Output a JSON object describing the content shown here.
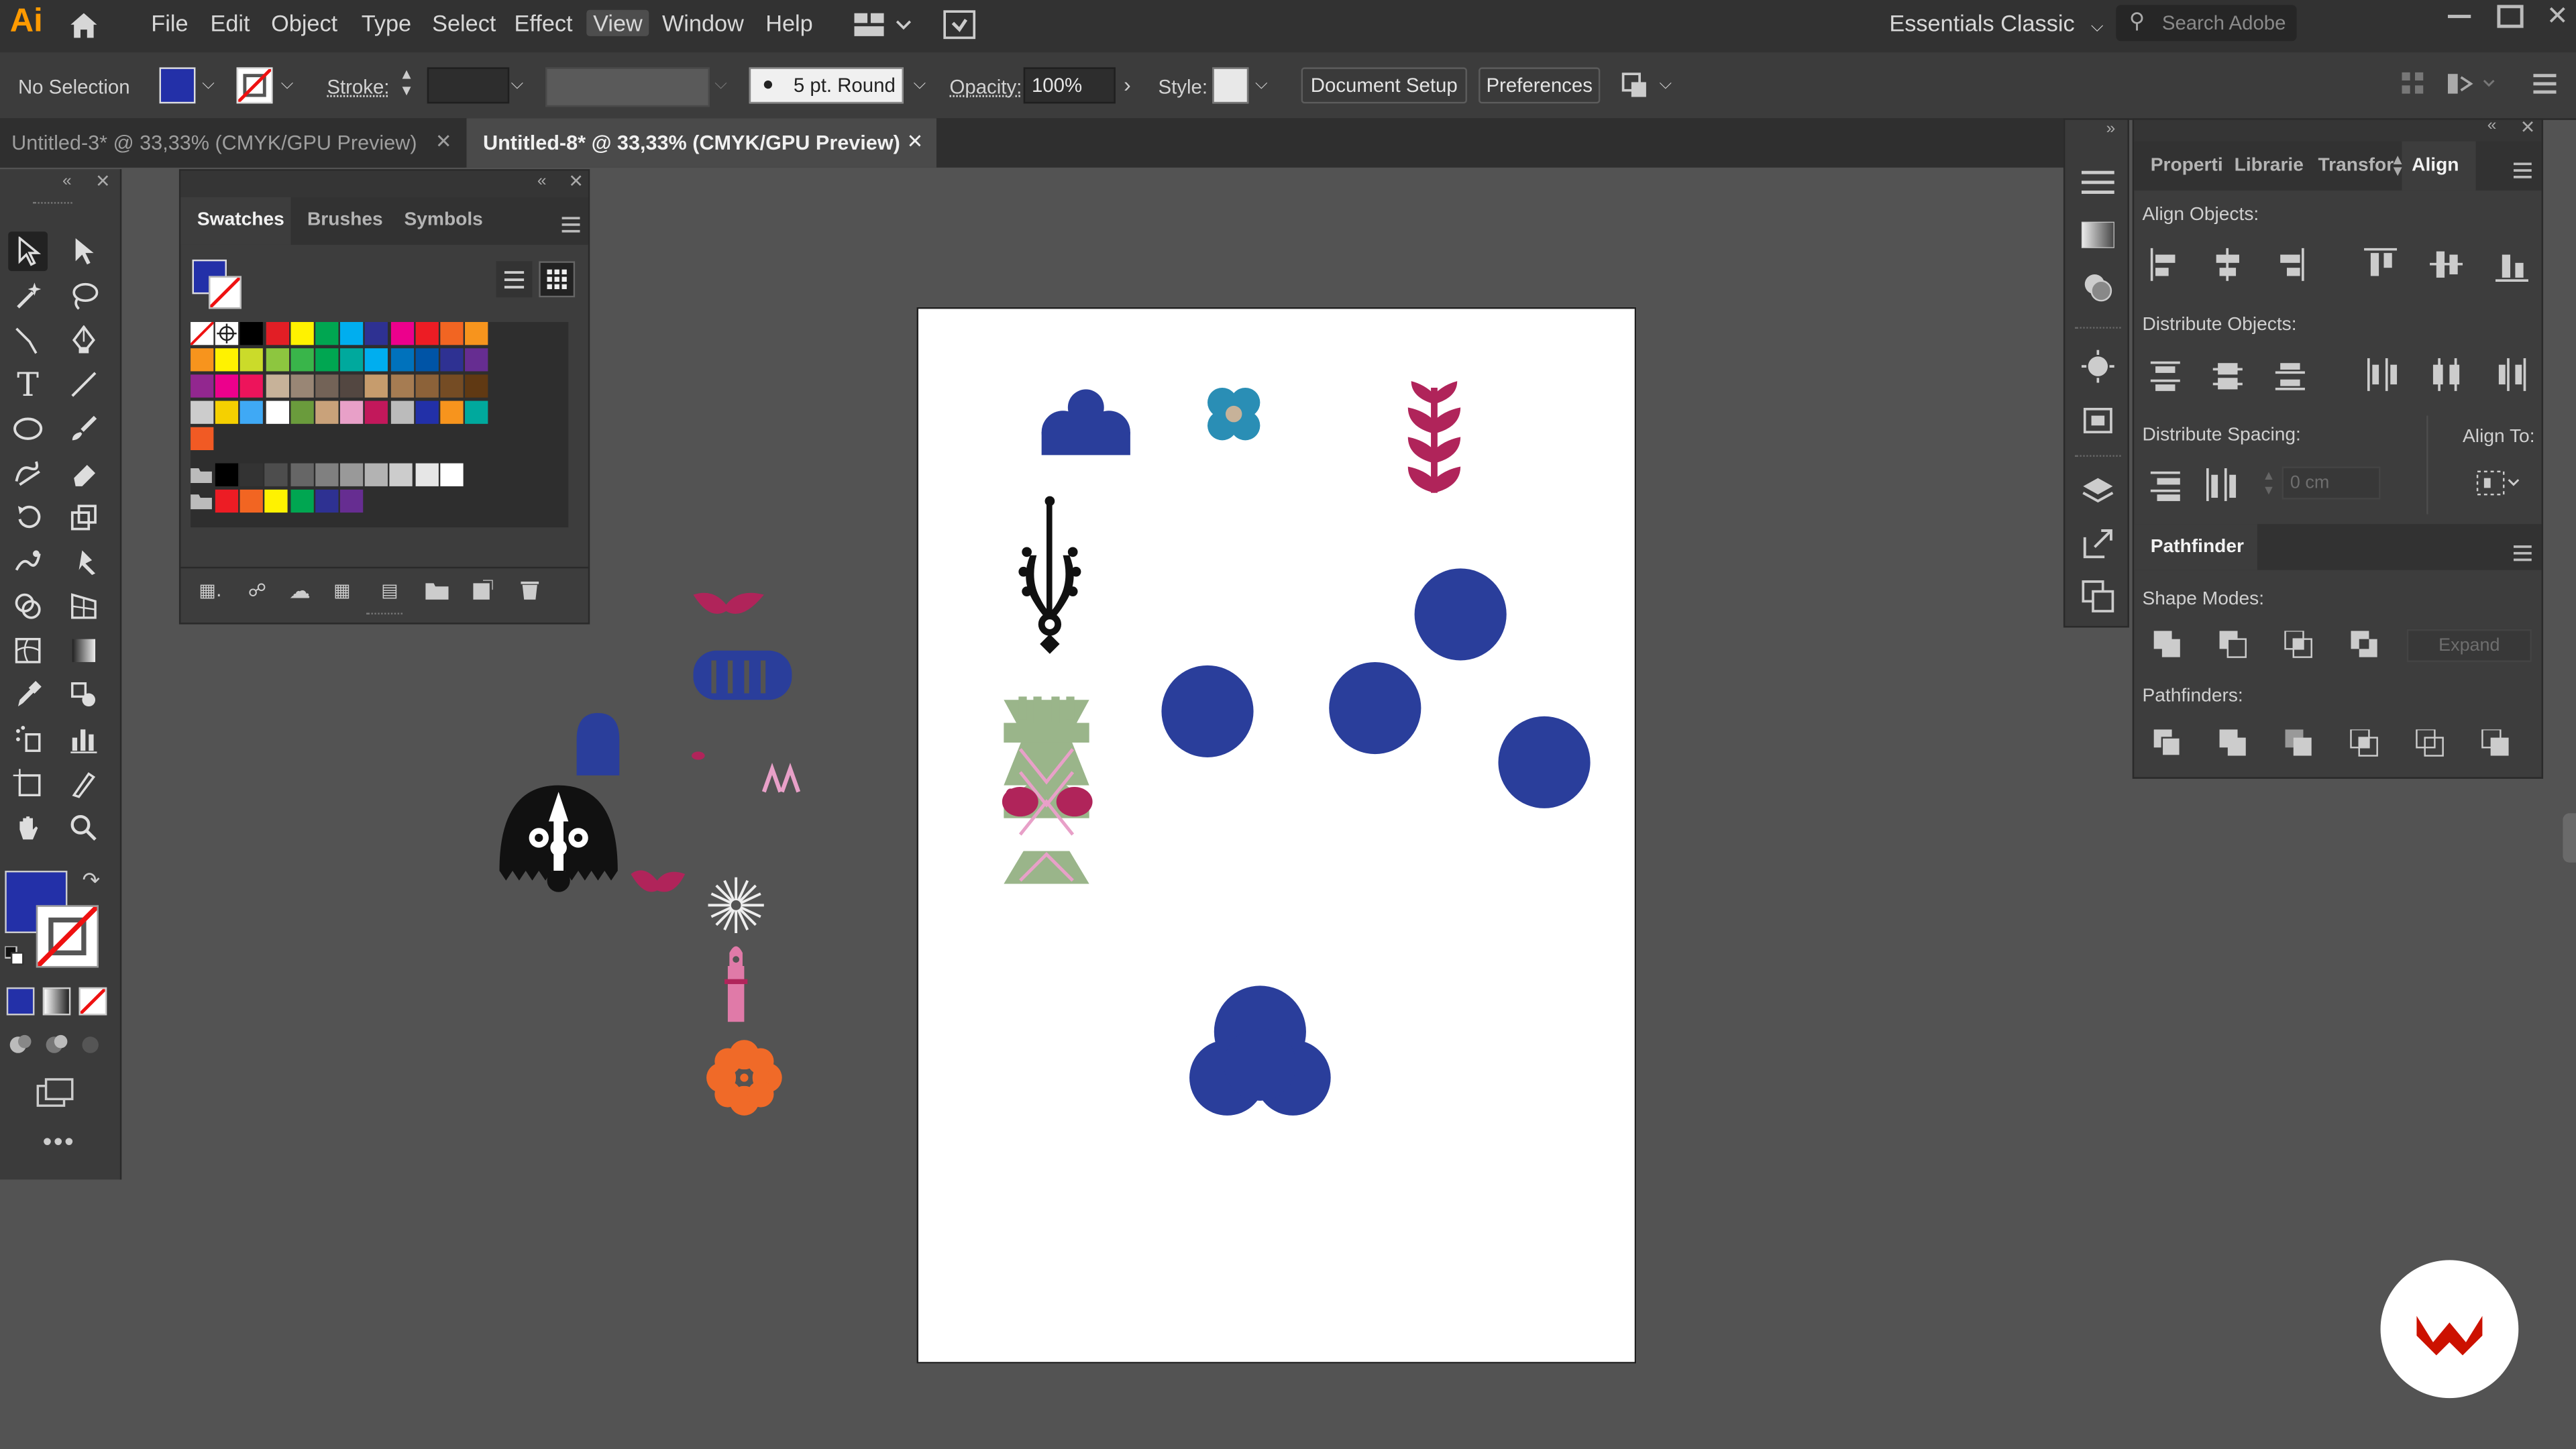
{
  "app": {
    "logo_text": "Ai",
    "menu": [
      "File",
      "Edit",
      "Object",
      "Type",
      "Select",
      "Effect",
      "View",
      "Window",
      "Help"
    ],
    "active_menu": "View",
    "workspace": "Essentials Classic",
    "search_placeholder": "Search Adobe"
  },
  "control_bar": {
    "selection": "No Selection",
    "stroke_label": "Stroke:",
    "brush": "5 pt. Round",
    "opacity_label": "Opacity:",
    "opacity_value": "100%",
    "style_label": "Style:",
    "document_setup": "Document Setup",
    "preferences": "Preferences"
  },
  "tabs": [
    {
      "label": "Untitled-3* @ 33,33% (CMYK/GPU Preview)",
      "active": false
    },
    {
      "label": "Untitled-8* @ 33,33% (CMYK/GPU Preview)",
      "active": true
    }
  ],
  "swatches_panel": {
    "tabs": [
      "Swatches",
      "Brushes",
      "Symbols"
    ],
    "active_tab": "Swatches",
    "row1": [
      "#000000",
      "#ffffff",
      "#000000",
      "#e21e25",
      "#fff200",
      "#00a651",
      "#00aeef",
      "#2e3192",
      "#ec008c",
      "#ed1c24",
      "#f26522",
      "#f7941d"
    ],
    "row2": [
      "#f7941d",
      "#fff200",
      "#cbdb2a",
      "#8dc63f",
      "#39b54a",
      "#00a651",
      "#00a99d",
      "#00aeef",
      "#0072bc",
      "#0054a6",
      "#2e3192",
      "#662d91"
    ],
    "row3": [
      "#92278f",
      "#ec008c",
      "#ed145b",
      "#c7b299",
      "#998675",
      "#736357",
      "#534741",
      "#c69c6d",
      "#a67c52",
      "#8c6239",
      "#754c24",
      "#603913"
    ],
    "row4": [
      "#cccccc",
      "#f5d000",
      "#3fa9f5",
      "#ffffff",
      "#6a9b3c",
      "#c9a27a",
      "#e8a0c8",
      "#c2185b",
      "#bbbbbb",
      "#2230a8",
      "#f7941d",
      "#00a99d"
    ],
    "row5": [
      "#f15a24"
    ],
    "gray_group": [
      "#000000",
      "#333333",
      "#4d4d4d",
      "#666666",
      "#808080",
      "#999999",
      "#b3b3b3",
      "#cccccc",
      "#e6e6e6",
      "#ffffff"
    ],
    "color_group": [
      "#ed1c24",
      "#f26522",
      "#fff200",
      "#00a651",
      "#2e3192",
      "#662d91"
    ]
  },
  "right_panel": {
    "tabs": [
      "Properti",
      "Librarie",
      "Transfor",
      "Align"
    ],
    "active_tab": "Align",
    "align_objects": "Align Objects:",
    "distribute_objects": "Distribute Objects:",
    "distribute_spacing": "Distribute Spacing:",
    "align_to": "Align To:",
    "spacing_value": "0 cm",
    "pathfinder_title": "Pathfinder",
    "shape_modes": "Shape Modes:",
    "expand": "Expand",
    "pathfinders": "Pathfinders:"
  },
  "colors": {
    "fill": "#2330a8",
    "accent_blue": "#2a3e9b",
    "magenta": "#b0245a",
    "teal": "#2a8eb5",
    "sage": "#9ab58a",
    "orange": "#f06a28",
    "logo_red": "#cc1100"
  }
}
